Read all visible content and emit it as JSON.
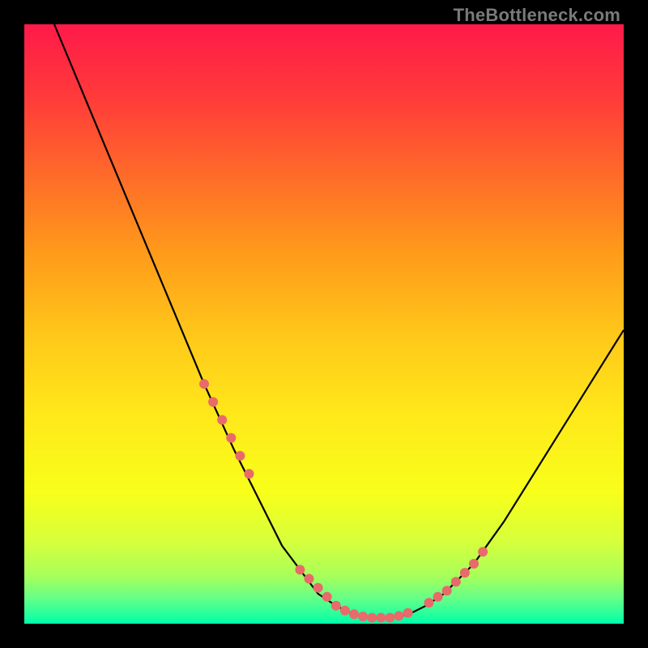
{
  "watermark": "TheBottleneck.com",
  "colors": {
    "frame": "#000000",
    "gradient_top": "#ff1a4a",
    "gradient_bottom": "#00ffaa",
    "curve": "#000000",
    "dots": "#e86a6a"
  },
  "chart_data": {
    "type": "line",
    "title": "",
    "xlabel": "",
    "ylabel": "",
    "xlim": [
      0,
      100
    ],
    "ylim": [
      0,
      100
    ],
    "grid": false,
    "legend": false,
    "series": [
      {
        "name": "bottleneck-curve",
        "x": [
          5,
          10,
          15,
          20,
          25,
          30,
          35,
          40,
          43,
          46,
          49,
          52,
          55,
          58,
          61,
          64,
          67,
          70,
          75,
          80,
          85,
          90,
          95,
          100
        ],
        "y": [
          100,
          88,
          76,
          64,
          52,
          40,
          29,
          19,
          13,
          9,
          5,
          3,
          1.5,
          1,
          1,
          1.5,
          3,
          5,
          10,
          17,
          25,
          33,
          41,
          49
        ]
      }
    ],
    "highlight_points": {
      "name": "marked-points",
      "x": [
        30,
        31.5,
        33,
        34.5,
        36,
        37.5,
        46,
        47.5,
        49,
        50.5,
        52,
        53.5,
        55,
        56.5,
        58,
        59.5,
        61,
        62.5,
        64,
        67.5,
        69,
        70.5,
        72,
        73.5,
        75,
        76.5
      ],
      "y": [
        40,
        37,
        34,
        31,
        28,
        25,
        9,
        7.5,
        6,
        4.5,
        3,
        2.2,
        1.6,
        1.2,
        1,
        1,
        1,
        1.3,
        1.8,
        3.5,
        4.5,
        5.5,
        7,
        8.5,
        10,
        12
      ]
    }
  }
}
